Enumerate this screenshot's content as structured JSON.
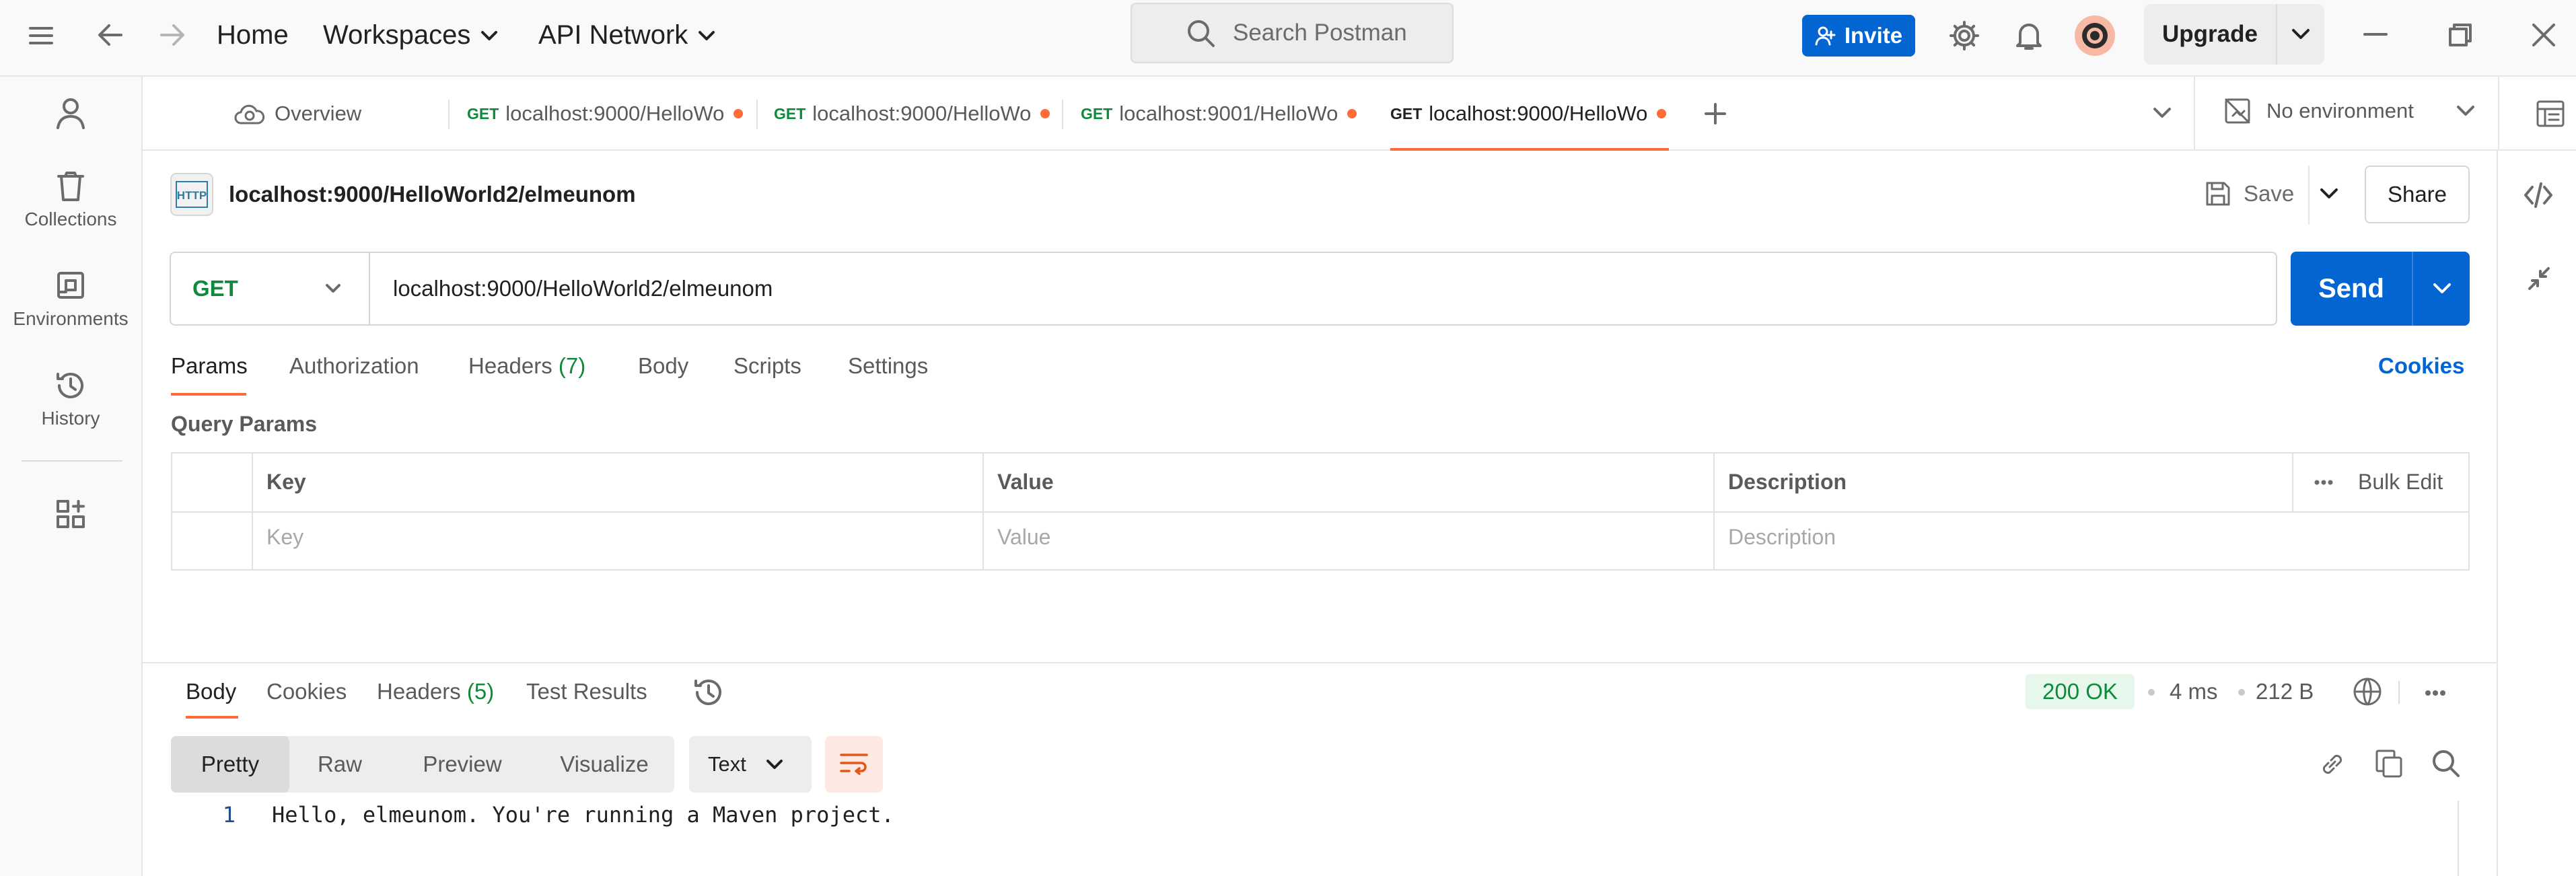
{
  "topbar": {
    "nav": {
      "home": "Home",
      "workspaces": "Workspaces",
      "api_network": "API Network"
    },
    "search_placeholder": "Search Postman",
    "invite": "Invite",
    "upgrade": "Upgrade"
  },
  "sidebar": {
    "items": [
      {
        "label": "Collections",
        "icon": "trash-bin-icon"
      },
      {
        "label": "Environments",
        "icon": "environment-icon"
      },
      {
        "label": "History",
        "icon": "history-icon"
      }
    ]
  },
  "tabs": {
    "overview": "Overview",
    "items": [
      {
        "method": "GET",
        "label": "localhost:9000/HelloWo",
        "unsaved": true
      },
      {
        "method": "GET",
        "label": "localhost:9000/HelloWo",
        "unsaved": true
      },
      {
        "method": "GET",
        "label": "localhost:9001/HelloWo",
        "unsaved": true
      },
      {
        "method": "GET",
        "label": "localhost:9000/HelloWo",
        "unsaved": true,
        "active": true
      }
    ],
    "environment": "No environment"
  },
  "request": {
    "title": "localhost:9000/HelloWorld2/elmeunom",
    "save": "Save",
    "share": "Share",
    "method": "GET",
    "url": "localhost:9000/HelloWorld2/elmeunom",
    "send": "Send",
    "tabs": {
      "params": "Params",
      "authorization": "Authorization",
      "headers": "Headers",
      "headers_count": "(7)",
      "body": "Body",
      "scripts": "Scripts",
      "settings": "Settings"
    },
    "cookies": "Cookies",
    "query_params_title": "Query Params",
    "table": {
      "headers": {
        "key": "Key",
        "value": "Value",
        "description": "Description"
      },
      "bulk_edit": "Bulk Edit",
      "placeholders": {
        "key": "Key",
        "value": "Value",
        "description": "Description"
      }
    }
  },
  "response": {
    "tabs": {
      "body": "Body",
      "cookies": "Cookies",
      "headers": "Headers",
      "headers_count": "(5)",
      "test_results": "Test Results"
    },
    "status": "200 OK",
    "time": "4 ms",
    "size": "212 B",
    "view_modes": [
      "Pretty",
      "Raw",
      "Preview",
      "Visualize"
    ],
    "format": "Text",
    "lines": [
      {
        "num": "1",
        "text": "Hello, elmeunom. You're running a Maven project."
      }
    ]
  },
  "colors": {
    "accent": "#ff6c37",
    "primary": "#0265d2",
    "get_method": "#0f8a3c",
    "status_ok_bg": "#e6f8ec"
  }
}
